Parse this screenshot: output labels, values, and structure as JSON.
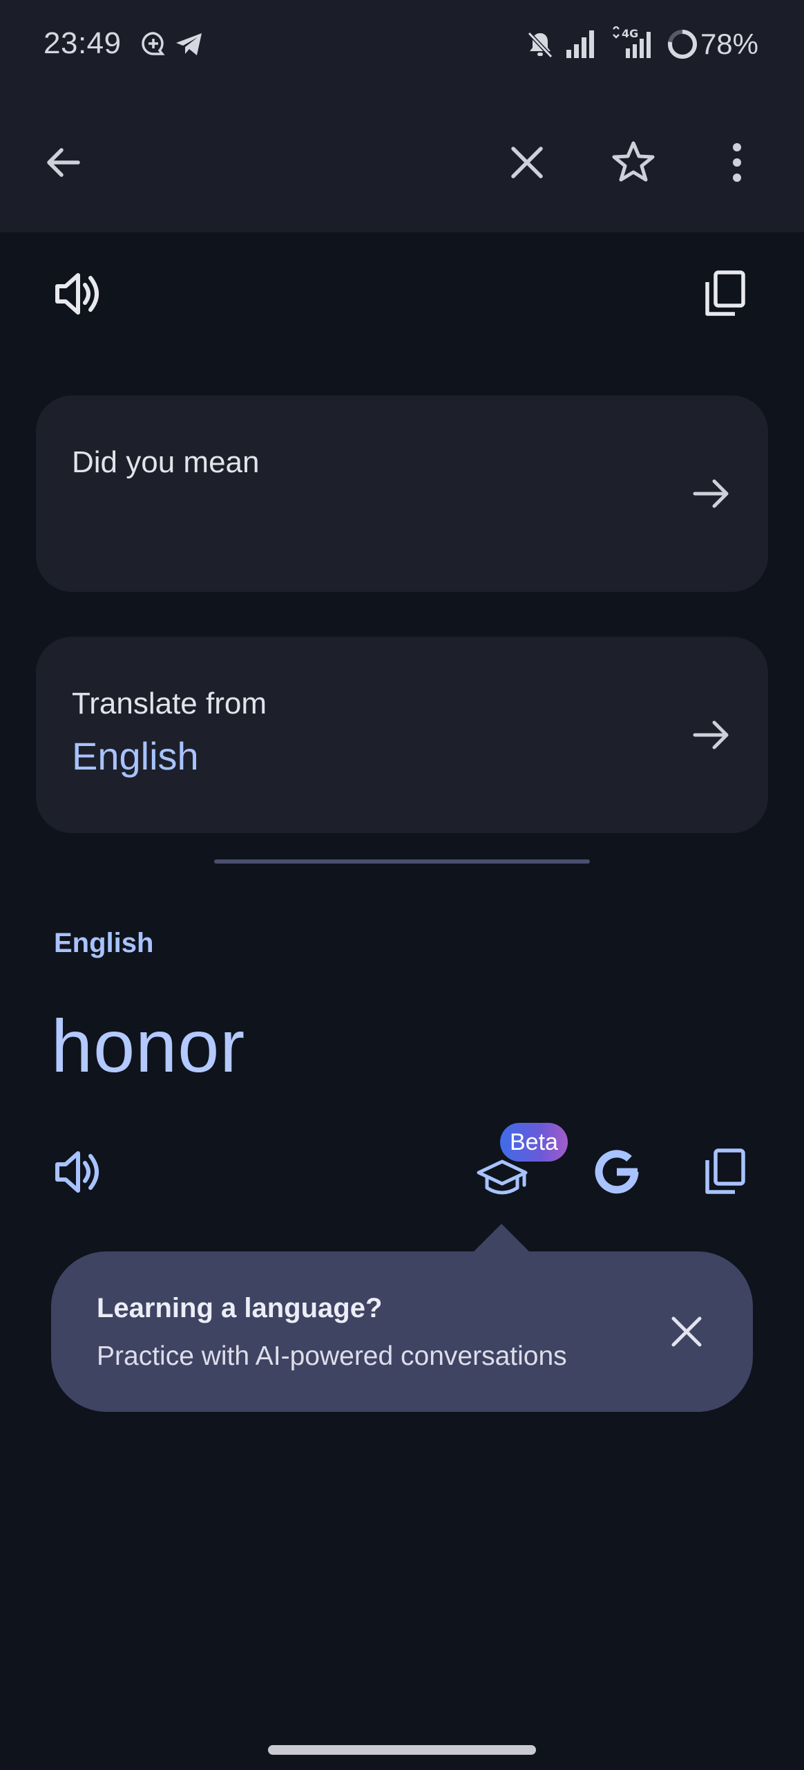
{
  "status_bar": {
    "time": "23:49",
    "battery": "78%",
    "network_label": "4G",
    "icons": [
      "chat-bubble-icon",
      "telegram-icon",
      "mute-bell-icon",
      "signal-icon",
      "signal-4g-icon",
      "battery-ring-icon"
    ]
  },
  "app_bar": {
    "icons": [
      "back-arrow-icon",
      "close-icon",
      "star-icon",
      "more-vert-icon"
    ]
  },
  "source": {
    "icons": [
      "speaker-icon",
      "copy-icon"
    ]
  },
  "cards": {
    "did_you_mean": {
      "label": "Did you mean"
    },
    "translate_from": {
      "label": "Translate from",
      "value": "English"
    }
  },
  "target": {
    "language": "English",
    "text": "honor",
    "badge": "Beta",
    "icons": [
      "speaker-icon",
      "learning-cap-icon",
      "google-g-icon",
      "copy-icon"
    ]
  },
  "tooltip": {
    "title": "Learning a language?",
    "body": "Practice with AI-powered conversations"
  },
  "colors": {
    "background": "#0f131c",
    "surface": "#1b1e29",
    "card": "#1d202b",
    "accent": "#a8c3ff",
    "tooltip": "#404463"
  }
}
